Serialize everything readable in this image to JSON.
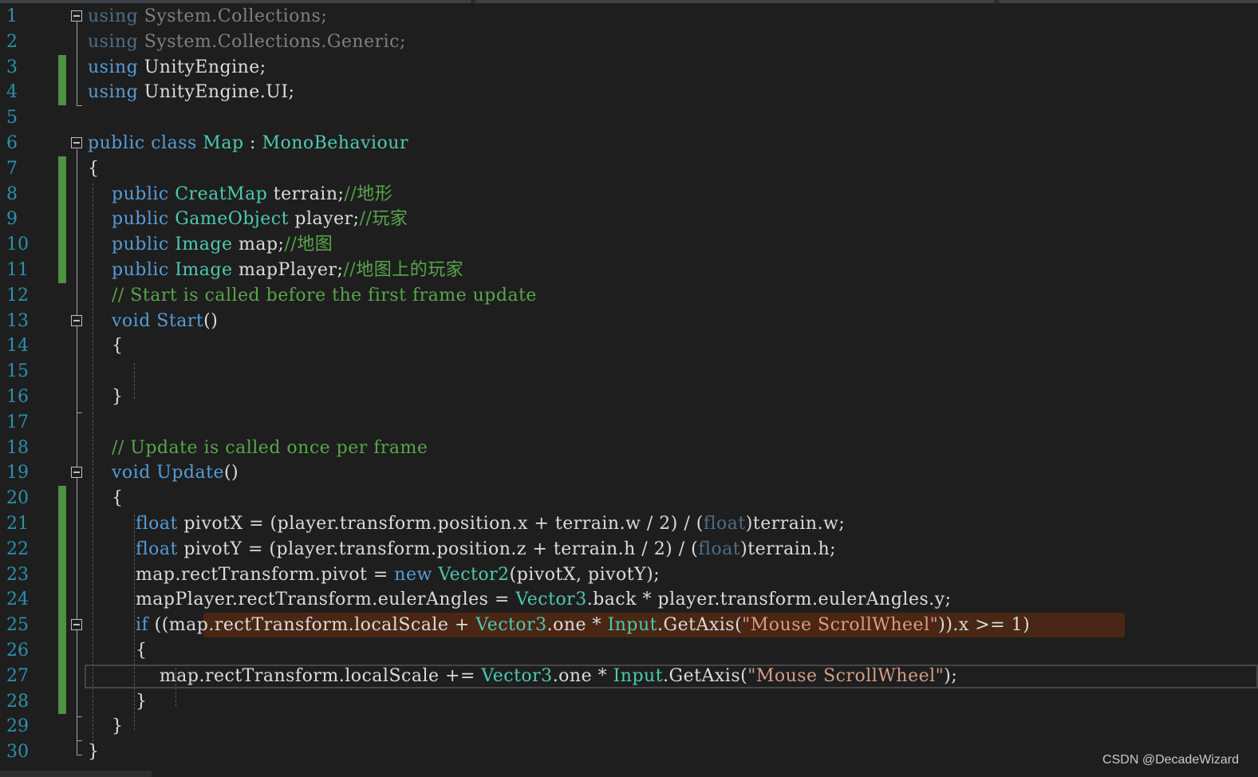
{
  "lines": [
    {
      "n": "1",
      "html": "<span class=\"kw dim\" style=\"color:#4f6e86\">using</span> <span class=\"dim\">System.Collections;</span>"
    },
    {
      "n": "2",
      "html": "<span class=\"kw dim\" style=\"color:#4f6e86\">using</span> <span class=\"dim\">System.Collections.Generic;</span>"
    },
    {
      "n": "3",
      "html": "<span class=\"kw\">using</span> UnityEngine;"
    },
    {
      "n": "4",
      "html": "<span class=\"kw\">using</span> UnityEngine.UI;"
    },
    {
      "n": "5",
      "html": ""
    },
    {
      "n": "6",
      "html": "<span class=\"kw\">public</span> <span class=\"kw\">class</span> <span class=\"ty\">Map</span> : <span class=\"ty\">MonoBehaviour</span>"
    },
    {
      "n": "7",
      "html": "{"
    },
    {
      "n": "8",
      "html": "    <span class=\"kw\">public</span> <span class=\"ty\">CreatMap</span> terrain;<span class=\"cm\">//地形</span>"
    },
    {
      "n": "9",
      "html": "    <span class=\"kw\">public</span> <span class=\"ty\">GameObject</span> player;<span class=\"cm\">//玩家</span>"
    },
    {
      "n": "10",
      "html": "    <span class=\"kw\">public</span> <span class=\"ty\">Image</span> map;<span class=\"cm\">//地图</span>"
    },
    {
      "n": "11",
      "html": "    <span class=\"kw\">public</span> <span class=\"ty\">Image</span> mapPlayer;<span class=\"cm\">//地图上的玩家</span>"
    },
    {
      "n": "12",
      "html": "    <span class=\"cm\">// Start is called before the first frame update</span>"
    },
    {
      "n": "13",
      "html": "    <span class=\"kw\">void</span> <span class=\"fn\" style=\"color:#569cd6\">Start</span>()"
    },
    {
      "n": "14",
      "html": "    {"
    },
    {
      "n": "15",
      "html": ""
    },
    {
      "n": "16",
      "html": "    }"
    },
    {
      "n": "17",
      "html": ""
    },
    {
      "n": "18",
      "html": "    <span class=\"cm\">// Update is called once per frame</span>"
    },
    {
      "n": "19",
      "html": "    <span class=\"kw\">void</span> <span class=\"fn\" style=\"color:#569cd6\">Update</span>()"
    },
    {
      "n": "20",
      "html": "    {"
    },
    {
      "n": "21",
      "html": "        <span class=\"kw\">float</span> pivotX = (player.transform.position.x + terrain.w / 2) / (<span class=\"kw dim\" style=\"color:#4f6e86\">float</span>)terrain.w;"
    },
    {
      "n": "22",
      "html": "        <span class=\"kw\">float</span> pivotY = (player.transform.position.z + terrain.h / 2) / (<span class=\"kw dim\" style=\"color:#4f6e86\">float</span>)terrain.h;"
    },
    {
      "n": "23",
      "html": "        map.rectTransform.pivot = <span class=\"kw\">new</span> <span class=\"ty\">Vector2</span>(pivotX, pivotY);"
    },
    {
      "n": "24",
      "html": "        mapPlayer.rectTransform.eulerAngles = <span class=\"ty\">Vector3</span>.back * player.transform.eulerAngles.y;"
    },
    {
      "n": "25",
      "html": "        <span class=\"kw\">if</span> ((map.rectTransform.localScale + <span class=\"ty\">Vector3</span>.one * <span class=\"ty\">Input</span>.GetAxis(<span class=\"st\">\"Mouse ScrollWheel\"</span>)).x &gt;= 1)"
    },
    {
      "n": "26",
      "html": "        {"
    },
    {
      "n": "27",
      "html": "            map.rectTransform.localScale += <span class=\"ty\">Vector3</span>.one * <span class=\"ty\">Input</span>.GetAxis(<span class=\"st\">\"Mouse ScrollWheel\"</span>);"
    },
    {
      "n": "28",
      "html": "        }"
    },
    {
      "n": "29",
      "html": "    }"
    },
    {
      "n": "30",
      "html": "}"
    }
  ],
  "changed_lines": [
    "3",
    "4",
    "7",
    "8",
    "9",
    "10",
    "11",
    "20",
    "21",
    "22",
    "23",
    "24",
    "25",
    "26",
    "27",
    "28"
  ],
  "fold_lines": [
    "1",
    "6",
    "13",
    "19",
    "25"
  ],
  "highlight_line": "25",
  "current_line": "27",
  "colors": {
    "background": "#1e1e1e",
    "keyword": "#569cd6",
    "type": "#4ec9b0",
    "comment": "#57a64a",
    "string": "#d69d85",
    "line_number": "#2b91af",
    "change_marker": "#57a64a",
    "highlight": "#5a2a12"
  },
  "watermark": "CSDN @DecadeWizard"
}
